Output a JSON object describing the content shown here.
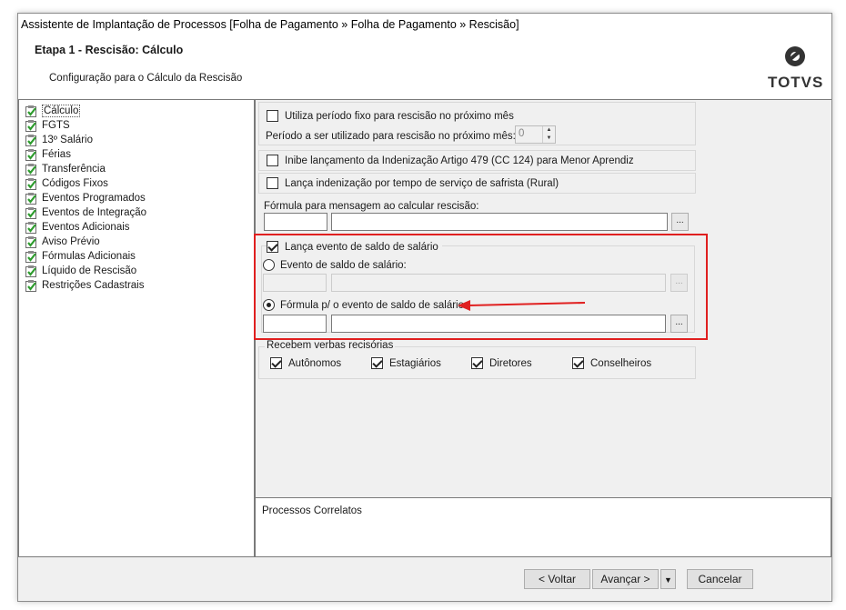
{
  "window": {
    "title": "Assistente de Implantação de Processos [Folha de Pagamento » Folha de Pagamento » Rescisão]"
  },
  "header": {
    "step_title": "Etapa 1 - Rescisão: Cálculo",
    "step_subtitle": "Configuração para o Cálculo da Rescisão",
    "logo_text": "TOTVS"
  },
  "tree": {
    "items": [
      {
        "label": "Cálculo",
        "selected": true
      },
      {
        "label": "FGTS"
      },
      {
        "label": "13º Salário"
      },
      {
        "label": "Férias"
      },
      {
        "label": "Transferência"
      },
      {
        "label": "Códigos Fixos"
      },
      {
        "label": "Eventos Programados"
      },
      {
        "label": "Eventos de Integração"
      },
      {
        "label": "Eventos Adicionais"
      },
      {
        "label": "Aviso Prévio"
      },
      {
        "label": "Fórmulas Adicionais"
      },
      {
        "label": "Líquido de Rescisão"
      },
      {
        "label": "Restrições Cadastrais"
      }
    ]
  },
  "form": {
    "periodo_fixo_label": "Utiliza período fixo para rescisão no próximo mês",
    "periodo_fixo_checked": false,
    "periodo_label": "Período a ser utilizado para rescisão no próximo mês:",
    "periodo_value": "0",
    "inibe_label": "Inibe lançamento da Indenização Artigo 479 (CC 124) para Menor Aprendiz",
    "inibe_checked": false,
    "safrista_label": "Lança indenização por tempo de serviço de safrista (Rural)",
    "safrista_checked": false,
    "formula_msg_label": "Fórmula para mensagem ao calcular rescisão:",
    "dots_label": "...",
    "lanca_saldo_label": "Lança evento de saldo de salário",
    "lanca_saldo_checked": true,
    "evento_saldo_label": "Evento de saldo de salário:",
    "formula_saldo_label": "Fórmula p/ o evento de saldo de salário:",
    "selected_option": "formula",
    "recebem_label": "Recebem verbas recisórias",
    "recebem": [
      {
        "label": "Autônomos",
        "checked": true
      },
      {
        "label": "Estagiários",
        "checked": true
      },
      {
        "label": "Diretores",
        "checked": true
      },
      {
        "label": "Conselheiros",
        "checked": true
      }
    ]
  },
  "related": {
    "label": "Processos Correlatos"
  },
  "footer": {
    "back": "< Voltar",
    "next": "Avançar >",
    "cancel": "Cancelar"
  },
  "colors": {
    "highlight": "#e02020",
    "check_green": "#2e9c2e"
  },
  "icons": {
    "tree_item": "checklist-icon",
    "dropdown": "arrow-down-icon",
    "annotation": "arrow-left-icon"
  }
}
